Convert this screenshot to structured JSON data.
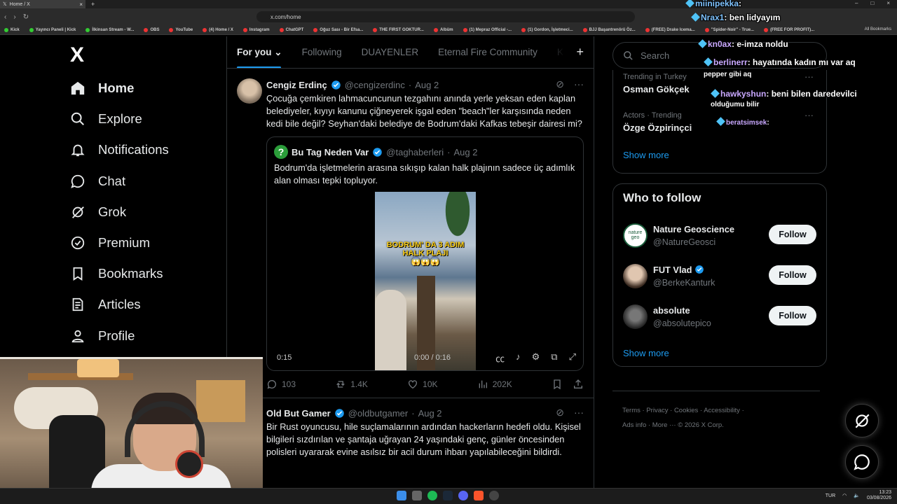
{
  "browser": {
    "tab_title": "Home / X",
    "url": "x.com/home",
    "bookmarks": [
      "Kick",
      "Yayıncı Paneli | Kick",
      "İlkinsan Stream - W...",
      "OBS",
      "YouTube",
      "(4) Home / X",
      "Instagram",
      "ChatGPT",
      "Oğuz Sası - Bir Efsa...",
      "THE FIRST GOKTUR...",
      "Albüm",
      "(1) Mepraz Official -...",
      "(1) Gordon, İşletmeci...",
      "BJJ Başantrenörü Öz...",
      "(FREE) Drake Icema...",
      "\"Spider-Noir\" - True...",
      "(FREE FOR PROFIT)..."
    ],
    "all_bookmarks": "All Bookmarks"
  },
  "sidebar": {
    "logo": "X",
    "items": [
      {
        "label": "Home",
        "icon": "home-icon"
      },
      {
        "label": "Explore",
        "icon": "search-icon"
      },
      {
        "label": "Notifications",
        "icon": "bell-icon"
      },
      {
        "label": "Chat",
        "icon": "chat-icon"
      },
      {
        "label": "Grok",
        "icon": "grok-icon"
      },
      {
        "label": "Premium",
        "icon": "verified-icon"
      },
      {
        "label": "Bookmarks",
        "icon": "bookmark-icon"
      },
      {
        "label": "Articles",
        "icon": "article-icon"
      },
      {
        "label": "Profile",
        "icon": "person-icon"
      }
    ]
  },
  "feed": {
    "tabs": [
      "For you",
      "Following",
      "DUAYENLER",
      "Eternal Fire Community",
      "Ka"
    ],
    "post1": {
      "name": "Cengiz Erdinç",
      "handle": "@cengizerdinc",
      "date": "Aug 2",
      "text": "Çocuğa çemkiren lahmacuncunun tezgahını anında yerle yeksan eden kaplan belediyeler, kıyıyı kanunu çiğneyerek işgal eden \"beach\"ler karşısında neden kedi bile değil? Seyhan'daki belediye de Bodrum'daki Kafkas tebeşir dairesi mi?",
      "quote": {
        "name": "Bu Tag Neden Var",
        "handle": "@taghaberleri",
        "date": "Aug 2",
        "text": "Bodrum'da işletmelerin arasına sıkışıp kalan halk plajının sadece üç adımlık alan olması tepki topluyor.",
        "video_caption": "BODRUM' DA 3 ADIM HALK PLAJI",
        "video_emoji": "😱😱😱",
        "time_left": "0:15",
        "time_progress": "0:00 / 0:16"
      },
      "stats": {
        "replies": "103",
        "reposts": "1.4K",
        "likes": "10K",
        "views": "202K"
      }
    },
    "post2": {
      "name": "Old But Gamer",
      "handle": "@oldbutgamer",
      "date": "Aug 2",
      "text": "Bir Rust oyuncusu, hile suçlamalarının ardından hackerların hedefi oldu. Kişisel bilgileri sızdırılan ve şantaja uğrayan 24 yaşındaki genç, günler öncesinden polisleri uyararak evine asılsız bir acil durum ihbarı yapılabileceğini bildirdi."
    }
  },
  "right": {
    "search_placeholder": "Search",
    "trends": [
      {
        "category": "Trending in Turkey",
        "title": "Osman Gökçek"
      },
      {
        "category": "Actors · Trending",
        "title": "Özge Özpirinçci"
      }
    ],
    "show_more": "Show more",
    "who_to_follow": {
      "title": "Who to follow",
      "people": [
        {
          "name": "Nature Geoscience",
          "handle": "@NatureGeosci",
          "verified": false,
          "avatar_text": "nature geo"
        },
        {
          "name": "FUT Vlad",
          "handle": "@BerkeKanturk",
          "verified": true,
          "avatar_text": ""
        },
        {
          "name": "absolute",
          "handle": "@absolutepico",
          "verified": false,
          "avatar_text": ""
        }
      ],
      "follow_label": "Follow",
      "show_more": "Show more"
    },
    "footer": {
      "links": [
        "Terms",
        "Privacy",
        "Cookies",
        "Accessibility",
        "Ads info",
        "More ···"
      ],
      "copyright": "© 2026 X Corp."
    }
  },
  "stream_chat": [
    {
      "user": "miinipekka",
      "msg": "",
      "color": "b"
    },
    {
      "user": "Nrax1",
      "msg": "ben lidyayım",
      "color": "b"
    },
    {
      "user": "kn0ax",
      "msg": "e-imza noldu",
      "color": ""
    },
    {
      "user": "berlinerr",
      "msg": "hayatında kadın mı var aq",
      "color": ""
    },
    {
      "user": "",
      "msg": "pepper gibi aq",
      "color": ""
    },
    {
      "user": "hawkyshun",
      "msg": "beni bilen daredevilci",
      "color": ""
    },
    {
      "user": "",
      "msg": "olduğumu bilir",
      "color": ""
    },
    {
      "user": "beratsimsek",
      "msg": "",
      "color": ""
    }
  ],
  "taskbar": {
    "lang": "TUR",
    "time": "13:23",
    "date": "03/08/2026"
  },
  "colors": {
    "accent": "#1d9bf0",
    "background": "#000000",
    "border": "#2f3336",
    "muted": "#71767b"
  }
}
